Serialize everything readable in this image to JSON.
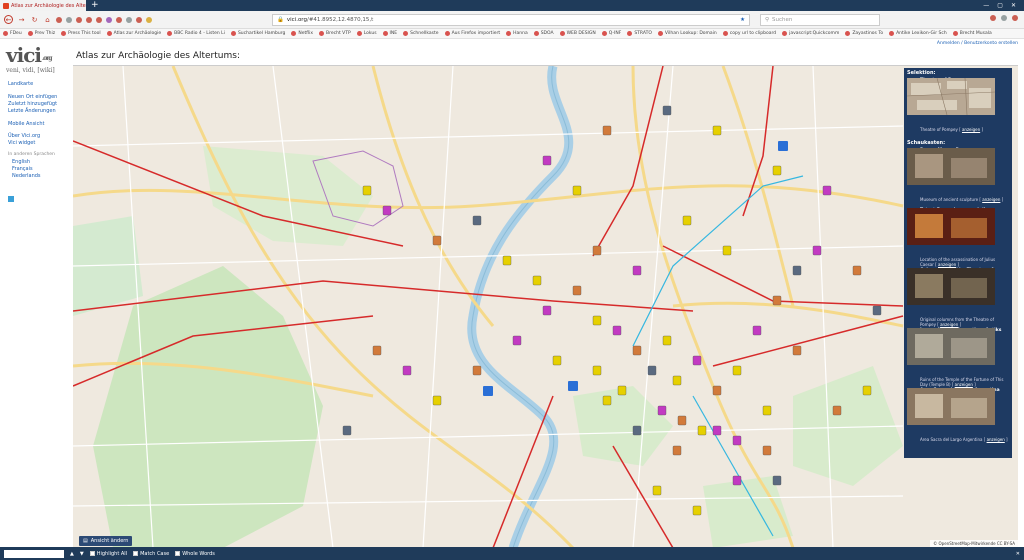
{
  "browser": {
    "tab_title": "Atlas zur Archäologie des Alte",
    "new_tab": "+",
    "url_host": "vici.org",
    "url_rest": "/#41.8952,12.4870,15,t",
    "search_placeholder": "Suchen",
    "bookmarks": [
      "FDeu",
      "Prev Thiz",
      "Press This tool",
      "Atlas zur Archäologie",
      "BBC Radio 4 - Listen Li",
      "Suchartikel Hamburg",
      "Netflix",
      "Brecht VTP",
      "Lokus",
      "INE",
      "Schnellkaste",
      "Aus Firefox importiert",
      "Hanna",
      "SDOA",
      "WEB DESIGN",
      "Q-INF",
      "STRATO",
      "Vilhan Lookup: Domain",
      "copy url to clipboard",
      "javascript:Quickcomm",
      "Zayastinos To",
      "Antike Lexikon-Gir Sch",
      "Brecht Musala"
    ]
  },
  "site": {
    "logo": "vici",
    "logo_tld": ".org",
    "tagline": "veni, vidi, [wiki]",
    "page_title": "Atlas zur Archäologie des Altertums:",
    "user_links": "Anmelden / Benutzerkonto erstellen"
  },
  "sidebar": {
    "landkarte": "Landkarte",
    "neuen_ort": "Neuen Ort einfügen",
    "zuletzt": "Zuletzt hinzugefügt",
    "letzte": "Letzte Änderungen",
    "mobile": "Mobile Ansicht",
    "ueber": "Über Vici.org",
    "widget": "Vici widget",
    "andere_sprachen": "In anderen Sprachen",
    "lang_en": "English",
    "lang_fr": "Français",
    "lang_nl": "Nederlands"
  },
  "map": {
    "ansicht_button": "Ansicht ändern",
    "attribution": "© OpenStreetMap-Mitwirkende CC BY-SA",
    "zoom_in": "+",
    "zoom_out": "−"
  },
  "panel": {
    "selektion_label": "Selektion:",
    "schaukasten_label": "Schaukasten:",
    "selection": {
      "title": "Theatre of Pompey",
      "caption": "Theatre of Pompey",
      "link": "anzeigen",
      "color": "#e07a1a"
    },
    "items": [
      {
        "title": "Rome, Museo Barracco",
        "caption": "Museum of ancient sculpture",
        "link": "anzeigen",
        "color": "#c23ac2"
      },
      {
        "title": "Tatort Ermordung von Julius Caesar",
        "caption": "Location of the assassination of Julius Caesar",
        "link": "anzeigen",
        "color": "#2a6fd6"
      },
      {
        "title": "Columns from the Theatre of Pompey",
        "caption": "Original columns from the Theatre of Pompey",
        "link": "anzeigen",
        "color": "#c23ac2"
      },
      {
        "title": "Largo di Torre Argentina, Antiks tortuna Remote Del",
        "caption": "Ruins of the Temple of the Fortune of This Day (Temple B)",
        "link": "anzeigen",
        "color": "#e6d000"
      },
      {
        "title": "Area Sacra del Largo Argentina",
        "caption": "Area Sacra del Largo Argentina",
        "link": "anzeigen",
        "color": "#e6d000"
      }
    ]
  },
  "findbar": {
    "highlight_all": "Highlight All",
    "match_case": "Match Case",
    "whole_words": "Whole Words"
  }
}
